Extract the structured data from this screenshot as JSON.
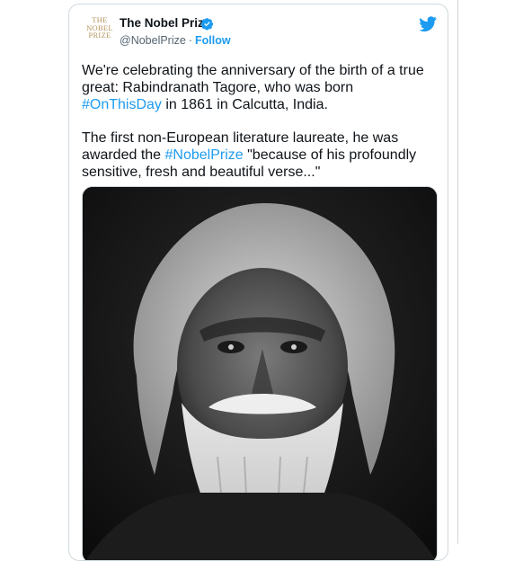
{
  "tweet": {
    "author": {
      "name": "The Nobel Prize",
      "handle": "@NobelPrize",
      "follow_label": "Follow",
      "logo_lines": [
        "THE",
        "NOBEL",
        "PRIZE"
      ]
    },
    "paragraph1": {
      "before": "We're celebrating the anniversary of the birth of a true great: Rabindranath Tagore, who was born ",
      "hashtag": "#OnThisDay",
      "after": " in 1861 in Calcutta, India."
    },
    "paragraph2": {
      "before": "The first non-European literature laureate, he was awarded the ",
      "hashtag": "#NobelPrize",
      "after": " \"because of his profoundly sensitive, fresh and beautiful verse...\""
    },
    "colors": {
      "accent": "#1d9bf0",
      "logo_gold": "#b4935a",
      "text": "#0f1419",
      "secondary": "#536471"
    },
    "icons": [
      "verified-badge-icon",
      "twitter-bird-icon"
    ]
  }
}
